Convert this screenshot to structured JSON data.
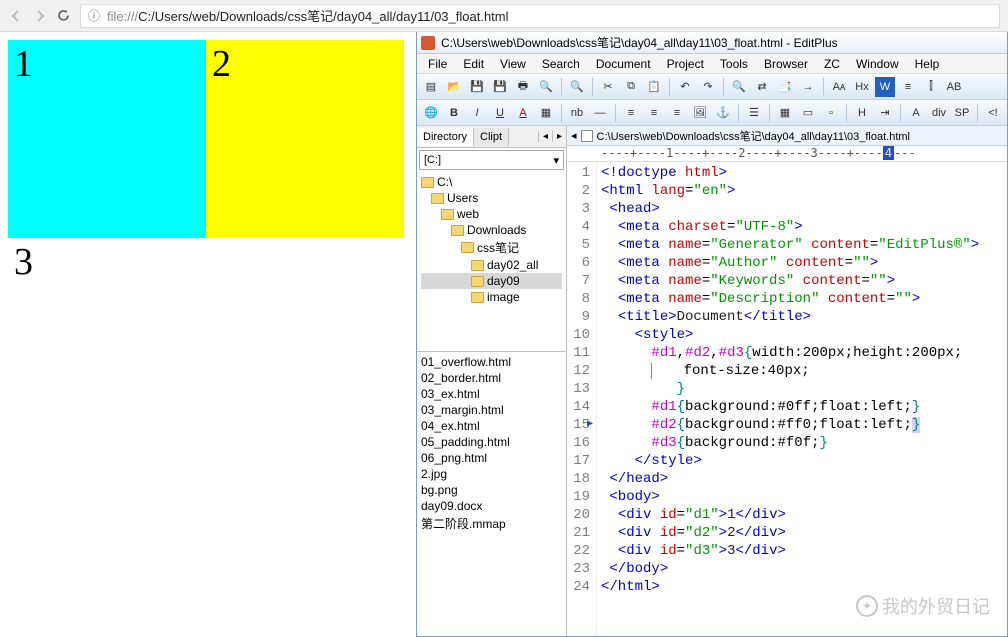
{
  "browser": {
    "url_prefix": "file:///",
    "url_path": "C:/Users/web/Downloads/css笔记/day04_all/day11/03_float.html"
  },
  "page": {
    "box1": "1",
    "box2": "2",
    "box3": "3"
  },
  "editor": {
    "title": "C:\\Users\\web\\Downloads\\css笔记\\day04_all\\day11\\03_float.html - EditPlus",
    "menu": [
      "File",
      "Edit",
      "View",
      "Search",
      "Document",
      "Project",
      "Tools",
      "Browser",
      "ZC",
      "Window",
      "Help"
    ],
    "tab_path": "C:\\Users\\web\\Downloads\\css笔记\\day04_all\\day11\\03_float.html",
    "ruler_text": "----+----1----+----2----+----3----+----",
    "ruler_current": "4",
    "ruler_tail": "---"
  },
  "sidebar": {
    "tabs": [
      "Directory",
      "Clipt"
    ],
    "drive": "[C:]",
    "tree": [
      {
        "label": "C:\\",
        "indent": 0
      },
      {
        "label": "Users",
        "indent": 1
      },
      {
        "label": "web",
        "indent": 2
      },
      {
        "label": "Downloads",
        "indent": 3
      },
      {
        "label": "css笔记",
        "indent": 4
      },
      {
        "label": "day02_all",
        "indent": 5
      },
      {
        "label": "day09",
        "indent": 5,
        "selected": true
      },
      {
        "label": "image",
        "indent": 5
      }
    ],
    "files": [
      "01_overflow.html",
      "02_border.html",
      "03_ex.html",
      "03_margin.html",
      "04_ex.html",
      "05_padding.html",
      "06_png.html",
      "2.jpg",
      "bg.png",
      "day09.docx",
      "第二阶段.mmap"
    ]
  },
  "toolbar1_icons": [
    "new-file-icon",
    "open-icon",
    "save-icon",
    "save-all-icon",
    "print-icon",
    "print-preview-icon",
    "sep",
    "find-icon",
    "sep",
    "cut-icon",
    "copy-icon",
    "paste-icon",
    "sep",
    "undo-icon",
    "redo-icon",
    "sep",
    "search-icon",
    "replace-icon",
    "find-in-files-icon",
    "goto-icon",
    "sep",
    "font-increase-icon",
    "hex-icon",
    "word-wrap-icon",
    "line-numbers-icon",
    "column-marker-icon",
    "syntax-icon"
  ],
  "toolbar2_icons": [
    "browser-icon",
    "bold-icon",
    "italic-icon",
    "underline-icon",
    "font-color-icon",
    "bg-color-icon",
    "sep",
    "nbsp-icon",
    "hr-icon",
    "sep",
    "align-left-icon",
    "align-center-icon",
    "align-right-icon",
    "image-icon",
    "anchor-icon",
    "sep",
    "list-icon",
    "sep",
    "table-icon",
    "tr-icon",
    "td-icon",
    "sep",
    "heading-icon",
    "indent-icon",
    "sep",
    "font-icon",
    "div-icon",
    "span-icon",
    "sep",
    "comment-icon"
  ],
  "code": {
    "lines": [
      {
        "n": 1,
        "html": "<span class='c-tag'>&lt;!doctype</span> <span class='c-attr'>html</span><span class='c-tag'>&gt;</span>"
      },
      {
        "n": 2,
        "html": "<span class='c-tag'>&lt;html</span> <span class='c-attr'>lang</span>=<span class='c-val'>\"en\"</span><span class='c-tag'>&gt;</span>"
      },
      {
        "n": 3,
        "html": " <span class='c-tag'>&lt;head&gt;</span>"
      },
      {
        "n": 4,
        "html": "  <span class='c-tag'>&lt;meta</span> <span class='c-attr'>charset</span>=<span class='c-val'>\"UTF-8\"</span><span class='c-tag'>&gt;</span>"
      },
      {
        "n": 5,
        "html": "  <span class='c-tag'>&lt;meta</span> <span class='c-attr'>name</span>=<span class='c-val'>\"Generator\"</span> <span class='c-attr'>content</span>=<span class='c-val'>\"EditPlus®\"</span><span class='c-tag'>&gt;</span>"
      },
      {
        "n": 6,
        "html": "  <span class='c-tag'>&lt;meta</span> <span class='c-attr'>name</span>=<span class='c-val'>\"Author\"</span> <span class='c-attr'>content</span>=<span class='c-val'>\"\"</span><span class='c-tag'>&gt;</span>"
      },
      {
        "n": 7,
        "html": "  <span class='c-tag'>&lt;meta</span> <span class='c-attr'>name</span>=<span class='c-val'>\"Keywords\"</span> <span class='c-attr'>content</span>=<span class='c-val'>\"\"</span><span class='c-tag'>&gt;</span>"
      },
      {
        "n": 8,
        "html": "  <span class='c-tag'>&lt;meta</span> <span class='c-attr'>name</span>=<span class='c-val'>\"Description\"</span> <span class='c-attr'>content</span>=<span class='c-val'>\"\"</span><span class='c-tag'>&gt;</span>"
      },
      {
        "n": 9,
        "html": "  <span class='c-tag'>&lt;title&gt;</span><span class='c-text'>Document</span><span class='c-tag'>&lt;/title&gt;</span>"
      },
      {
        "n": 10,
        "html": "    <span class='c-tag'>&lt;style&gt;</span>"
      },
      {
        "n": 11,
        "html": "      <span class='c-sel'>#d1</span>,<span class='c-sel'>#d2</span>,<span class='c-sel'>#d3</span><span class='c-brace'>{</span>width:200px;height:200px;"
      },
      {
        "n": 12,
        "html": "      <span style='border-left:1px solid #888;padding-left:6px;'>   font-size:40px;</span>"
      },
      {
        "n": 13,
        "html": "         <span class='c-brace'>}</span>"
      },
      {
        "n": 14,
        "html": "      <span class='c-sel'>#d1</span><span class='c-brace'>{</span>background:#0ff;float:left;<span class='c-brace'>}</span>"
      },
      {
        "n": 15,
        "html": "      <span class='c-sel'>#d2</span><span class='c-brace'>{</span>background:#ff0;float:left;<span class='c-brace' style='background:#d0d0ff;'>}</span>",
        "marker": true
      },
      {
        "n": 16,
        "html": "      <span class='c-sel'>#d3</span><span class='c-brace'>{</span>background:#f0f;<span class='c-brace'>}</span>"
      },
      {
        "n": 17,
        "html": "    <span class='c-tag'>&lt;/style&gt;</span>"
      },
      {
        "n": 18,
        "html": " <span class='c-tag'>&lt;/head&gt;</span>"
      },
      {
        "n": 19,
        "html": " <span class='c-tag'>&lt;body&gt;</span>"
      },
      {
        "n": 20,
        "html": "  <span class='c-tag'>&lt;div</span> <span class='c-attr'>id</span>=<span class='c-val'>\"d1\"</span><span class='c-tag'>&gt;</span><span class='c-text'>1</span><span class='c-tag'>&lt;/div&gt;</span>"
      },
      {
        "n": 21,
        "html": "  <span class='c-tag'>&lt;div</span> <span class='c-attr'>id</span>=<span class='c-val'>\"d2\"</span><span class='c-tag'>&gt;</span><span class='c-text'>2</span><span class='c-tag'>&lt;/div&gt;</span>"
      },
      {
        "n": 22,
        "html": "  <span class='c-tag'>&lt;div</span> <span class='c-attr'>id</span>=<span class='c-val'>\"d3\"</span><span class='c-tag'>&gt;</span><span class='c-text'>3</span><span class='c-tag'>&lt;/div&gt;</span>"
      },
      {
        "n": 23,
        "html": " <span class='c-tag'>&lt;/body&gt;</span>"
      },
      {
        "n": 24,
        "html": "<span class='c-tag'>&lt;/html&gt;</span>"
      }
    ]
  },
  "watermark": "我的外贸日记"
}
